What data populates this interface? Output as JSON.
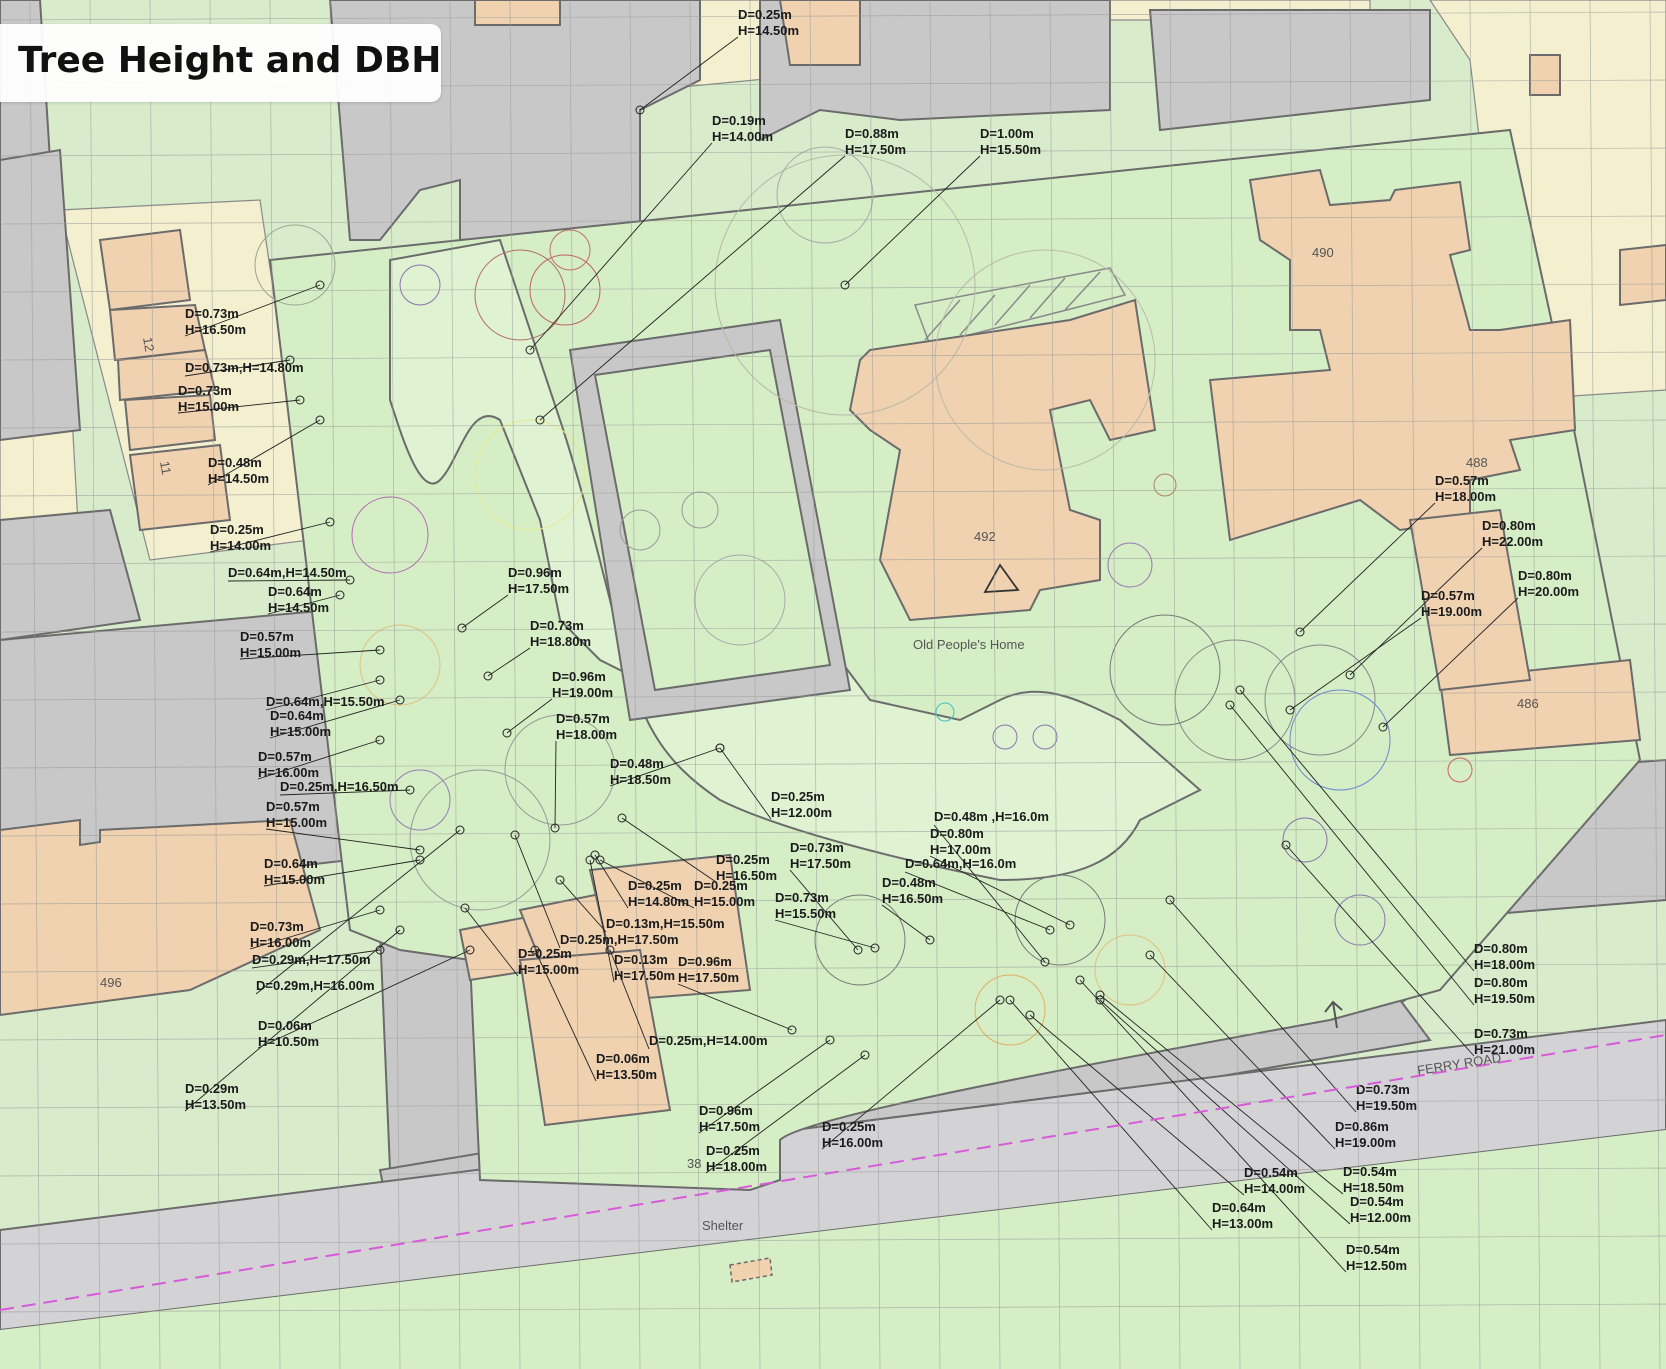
{
  "map_title": "Tree Height and DBH",
  "place_labels": {
    "old_peoples_home": "Old People's Home",
    "ferry_road": "FERRY ROAD",
    "shelter": "Shelter",
    "no_490": "490",
    "no_492": "492",
    "no_488": "488",
    "no_486": "486",
    "no_496": "496",
    "no_12": "12",
    "no_11": "11",
    "no_38": "38"
  },
  "colors": {
    "building": "#f0d1b0",
    "paved": "#c8c8c9",
    "road": "#d3d3d5",
    "green": "#d5eec5",
    "yard": "#f3efcf",
    "outline": "#6b6b6b",
    "dashed_line": "#d85ad8",
    "grid": "#9a9a9a"
  },
  "tree_labels": [
    {
      "line1": "D=0.25m",
      "line2": "H=14.50m"
    },
    {
      "line1": "D=0.19m",
      "line2": "H=14.00m"
    },
    {
      "line1": "D=0.88m",
      "line2": "H=17.50m"
    },
    {
      "line1": "D=1.00m",
      "line2": "H=15.50m"
    },
    {
      "line1": "D=0.73m",
      "line2": "H=16.50m"
    },
    {
      "line1": "D=0.73m,H=14.80m",
      "line2": ""
    },
    {
      "line1": "D=0.73m",
      "line2": "H=15.00m"
    },
    {
      "line1": "D=0.48m",
      "line2": "H=14.50m"
    },
    {
      "line1": "D=0.25m",
      "line2": "H=14.00m"
    },
    {
      "line1": "D=0.64m,H=14.50m",
      "line2": ""
    },
    {
      "line1": "D=0.64m",
      "line2": "H=14.50m"
    },
    {
      "line1": "D=0.57m",
      "line2": "H=15.00m"
    },
    {
      "line1": "D=0.64m,H=15.50m",
      "line2": ""
    },
    {
      "line1": "D=0.64m",
      "line2": "H=15.00m"
    },
    {
      "line1": "D=0.57m",
      "line2": "H=16.00m"
    },
    {
      "line1": "D=0.25m,H=16.50m",
      "line2": ""
    },
    {
      "line1": "D=0.57m",
      "line2": "H=15.00m"
    },
    {
      "line1": "D=0.64m",
      "line2": "H=15.00m"
    },
    {
      "line1": "D=0.73m",
      "line2": "H=16.00m"
    },
    {
      "line1": "D=0.29m,H=17.50m",
      "line2": ""
    },
    {
      "line1": "D=0.29m,H=16.00m",
      "line2": ""
    },
    {
      "line1": "D=0.06m",
      "line2": "H=10.50m"
    },
    {
      "line1": "D=0.29m",
      "line2": "H=13.50m"
    },
    {
      "line1": "D=0.96m",
      "line2": "H=17.50m"
    },
    {
      "line1": "D=0.73m",
      "line2": "H=18.80m"
    },
    {
      "line1": "D=0.96m",
      "line2": "H=19.00m"
    },
    {
      "line1": "D=0.57m",
      "line2": "H=18.00m"
    },
    {
      "line1": "D=0.48m",
      "line2": "H=18.50m"
    },
    {
      "line1": "D=0.25m",
      "line2": "H=12.00m"
    },
    {
      "line1": "D=0.25m",
      "line2": "H=16.50m"
    },
    {
      "line1": "D=0.25m",
      "line2": "H=14.80m"
    },
    {
      "line1": "D=0.25m",
      "line2": "H=15.00m"
    },
    {
      "line1": "D=0.13m,H=15.50m",
      "line2": ""
    },
    {
      "line1": "D=0.25m,H=17.50m",
      "line2": ""
    },
    {
      "line1": "D=0.25m",
      "line2": "H=15.00m"
    },
    {
      "line1": "D=0.13m",
      "line2": "H=17.50m"
    },
    {
      "line1": "D=0.96m",
      "line2": "H=17.50m"
    },
    {
      "line1": "D=0.25m,H=14.00m",
      "line2": ""
    },
    {
      "line1": "D=0.06m",
      "line2": "H=13.50m"
    },
    {
      "line1": "D=0.96m",
      "line2": "H=17.50m"
    },
    {
      "line1": "D=0.25m",
      "line2": "H=18.00m"
    },
    {
      "line1": "D=0.25m",
      "line2": "H=16.00m"
    },
    {
      "line1": "D=0.73m",
      "line2": "H=17.50m"
    },
    {
      "line1": "D=0.73m",
      "line2": "H=15.50m"
    },
    {
      "line1": "D=0.48m",
      "line2": "H=16.50m"
    },
    {
      "line1": "D=0.48m ,H=16.0m",
      "line2": ""
    },
    {
      "line1": "D=0.80m",
      "line2": "H=17.00m"
    },
    {
      "line1": "D=0.64m,H=16.0m",
      "line2": ""
    },
    {
      "line1": "D=0.57m",
      "line2": "H=18.00m"
    },
    {
      "line1": "D=0.80m",
      "line2": "H=22.00m"
    },
    {
      "line1": "D=0.80m",
      "line2": "H=20.00m"
    },
    {
      "line1": "D=0.57m",
      "line2": "H=19.00m"
    },
    {
      "line1": "D=0.80m",
      "line2": "H=18.00m"
    },
    {
      "line1": "D=0.80m",
      "line2": "H=19.50m"
    },
    {
      "line1": "D=0.73m",
      "line2": "H=21.00m"
    },
    {
      "line1": "D=0.73m",
      "line2": "H=19.50m"
    },
    {
      "line1": "D=0.86m",
      "line2": "H=19.00m"
    },
    {
      "line1": "D=0.54m",
      "line2": "H=14.00m"
    },
    {
      "line1": "D=0.54m",
      "line2": "H=18.50m"
    },
    {
      "line1": "D=0.54m",
      "line2": "H=12.00m"
    },
    {
      "line1": "D=0.64m",
      "line2": "H=13.00m"
    },
    {
      "line1": "D=0.54m",
      "line2": "H=12.50m"
    }
  ]
}
